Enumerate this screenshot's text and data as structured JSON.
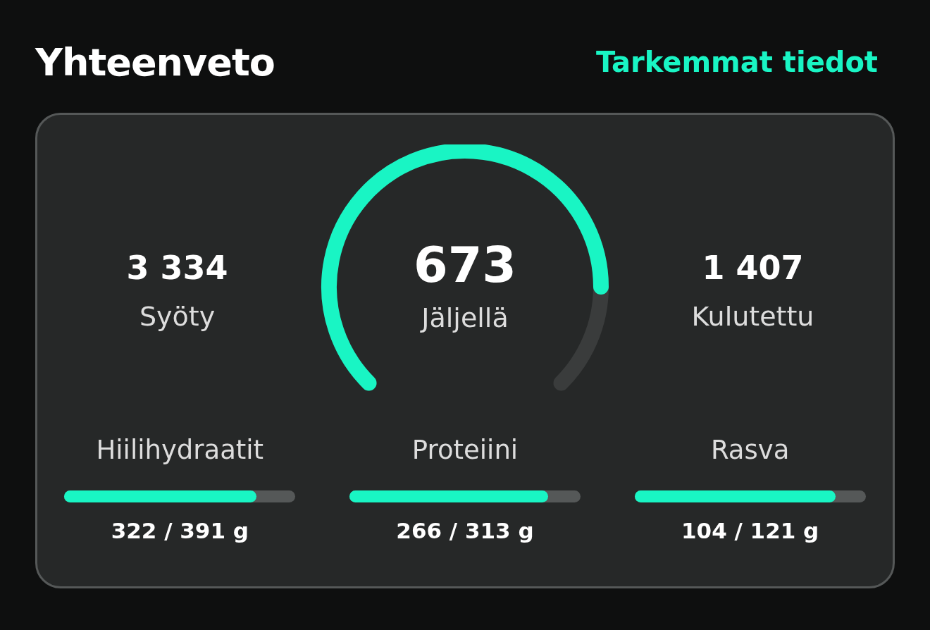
{
  "header": {
    "title": "Yhteenveto",
    "link": "Tarkemmat tiedot"
  },
  "summary": {
    "eaten": {
      "value": "3 334",
      "label": "Syöty"
    },
    "remaining": {
      "value": "673",
      "label": "Jäljellä"
    },
    "burned": {
      "value": "1 407",
      "label": "Kulutettu"
    }
  },
  "macros": [
    {
      "name": "Hiilihydraatit",
      "level": 0.83,
      "amount": "322 / 391 g"
    },
    {
      "name": "Proteiini",
      "level": 0.86,
      "amount": "266 / 313 g"
    },
    {
      "name": "Rasva",
      "level": 0.87,
      "amount": "104 / 121 g"
    }
  ]
}
